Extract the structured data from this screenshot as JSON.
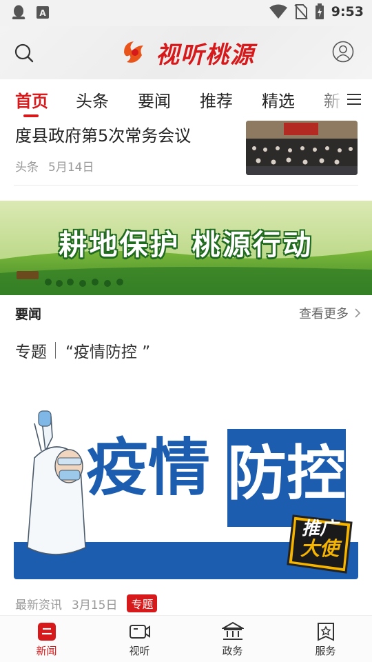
{
  "status_bar": {
    "time": "9:53",
    "icons": [
      "qq-icon",
      "keyboard-a-icon",
      "wifi-icon",
      "no-sim-icon",
      "battery-charging-icon"
    ]
  },
  "header": {
    "logo_text": "视听桃源",
    "search_icon": "search-icon",
    "user_icon": "user-icon"
  },
  "tabs": [
    {
      "label": "首页",
      "active": true
    },
    {
      "label": "头条",
      "active": false
    },
    {
      "label": "要闻",
      "active": false
    },
    {
      "label": "推荐",
      "active": false
    },
    {
      "label": "精选",
      "active": false
    },
    {
      "label": "新",
      "active": false
    }
  ],
  "news_item": {
    "title": "度县政府第5次常务会议",
    "category": "头条",
    "date": "5月14日"
  },
  "banner": {
    "title": "耕地保护 桃源行动"
  },
  "section": {
    "title": "要闻",
    "more_label": "查看更多"
  },
  "topic": {
    "label": "专题",
    "name": "“疫情防控 ”",
    "image_left_text": "疫情",
    "image_right_text": "防控",
    "badge_line1": "推广",
    "badge_line2": "大使",
    "meta_source": "最新资讯",
    "meta_date": "3月15日",
    "meta_tag": "专题"
  },
  "bottom_nav": [
    {
      "label": "新闻",
      "icon": "news-icon",
      "active": true
    },
    {
      "label": "视听",
      "icon": "video-icon",
      "active": false
    },
    {
      "label": "政务",
      "icon": "government-icon",
      "active": false
    },
    {
      "label": "服务",
      "icon": "service-icon",
      "active": false
    }
  ],
  "colors": {
    "brand_red": "#d6191b",
    "topic_blue": "#1c5db0",
    "banner_green": "#3f8a2a"
  }
}
